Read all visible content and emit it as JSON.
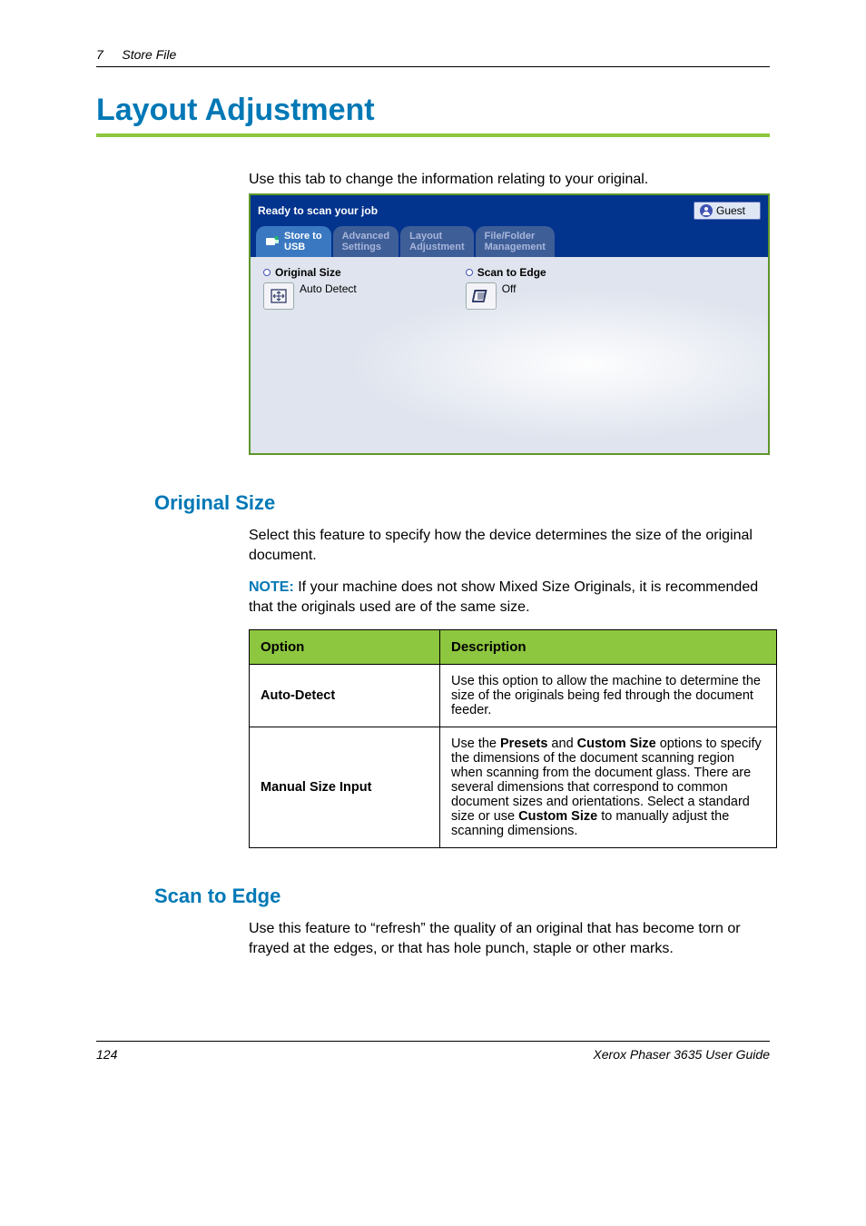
{
  "header": {
    "chapter_num": "7",
    "chapter_title": "Store File"
  },
  "title": "Layout Adjustment",
  "intro": "Use this tab to change the information relating to your original.",
  "device_ui": {
    "status": "Ready to scan your job",
    "guest": "Guest",
    "tabs": {
      "store": {
        "line1": "Store to",
        "line2": "USB"
      },
      "advanced": {
        "line1": "Advanced",
        "line2": "Settings"
      },
      "layout": {
        "line1": "Layout",
        "line2": "Adjustment"
      },
      "filefolder": {
        "line1": "File/Folder",
        "line2": "Management"
      }
    },
    "opts": {
      "original_size": {
        "title": "Original Size",
        "value": "Auto Detect"
      },
      "scan_to_edge": {
        "title": "Scan to Edge",
        "value": "Off"
      }
    }
  },
  "sections": {
    "original_size": {
      "heading": "Original Size",
      "p1": "Select this feature to specify how the device determines the size of the original document.",
      "note_label": "NOTE:",
      "note_text": " If your machine does not show Mixed Size Originals, it is recommended that the originals used are of the same size.",
      "th_option": "Option",
      "th_desc": "Description",
      "rows": [
        {
          "name": "Auto-Detect",
          "desc": "Use this option to allow the machine to determine the size of the originals being fed through the document feeder."
        },
        {
          "name": "Manual Size Input",
          "desc_pre": "Use the ",
          "b1": "Presets",
          "mid1": " and ",
          "b2": "Custom Size",
          "mid2": " options to specify the dimensions of the document scanning region when scanning from the document glass. There are several dimensions that correspond to common document sizes and orientations. Select a standard size or use ",
          "b3": "Custom Size",
          "post": " to manually adjust the scanning dimensions."
        }
      ]
    },
    "scan_to_edge": {
      "heading": "Scan to Edge",
      "p1": "Use this feature to “refresh” the quality of an original that has become torn or frayed at the edges, or that has hole punch, staple or other marks."
    }
  },
  "footer": {
    "page": "124",
    "doc": "Xerox Phaser 3635 User Guide"
  }
}
